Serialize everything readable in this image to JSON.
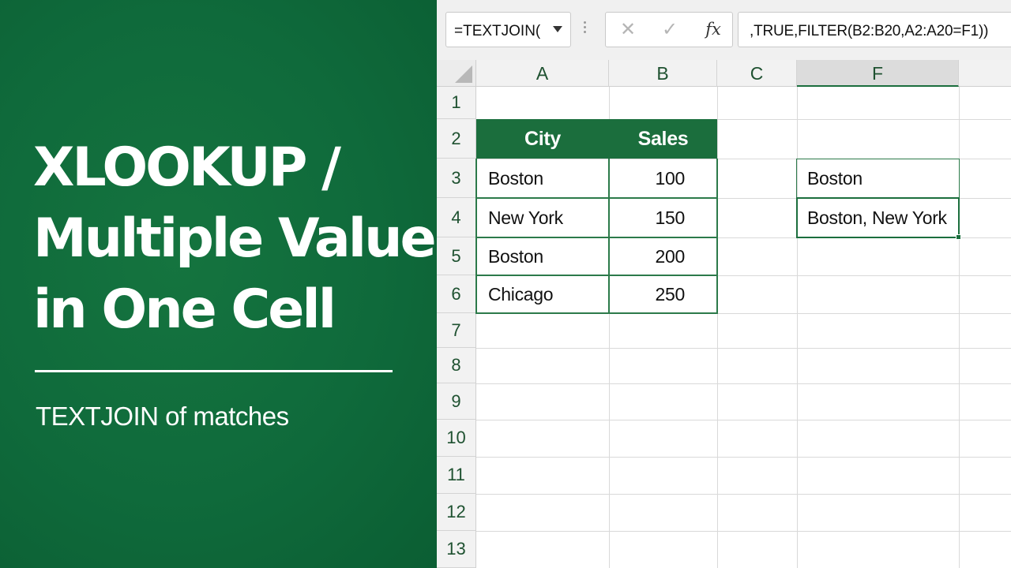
{
  "banner": {
    "title_lines": [
      "XLOOKUP /",
      "Multiple Values /",
      "in One Cell"
    ],
    "subtitle": "TEXTJOIN of matches",
    "background_color": "#0f6a3b"
  },
  "formula_bar": {
    "name_box": "=TEXTJOIN(",
    "dropdown_icon": "chevron-down-icon",
    "cancel_icon": "✕",
    "confirm_icon": "✓",
    "fx_label": "fx",
    "formula": ",TRUE,FILTER(B2:B20,A2:A20=F1))"
  },
  "grid": {
    "columns": [
      "A",
      "B",
      "C",
      "F"
    ],
    "selected_column": "F",
    "rows": [
      "1",
      "2",
      "3",
      "4",
      "5",
      "6",
      "7",
      "8",
      "9",
      "10",
      "11",
      "12",
      "13"
    ],
    "table": {
      "headers": [
        "City",
        "Sales"
      ],
      "rows": [
        [
          "Boston",
          "100"
        ],
        [
          "New York",
          "150"
        ],
        [
          "Boston",
          "200"
        ],
        [
          "Chicago",
          "250"
        ]
      ]
    },
    "f_cells": {
      "f3": "Boston",
      "f4": "Boston, New York"
    },
    "accent_color": "#1b6e3d"
  }
}
